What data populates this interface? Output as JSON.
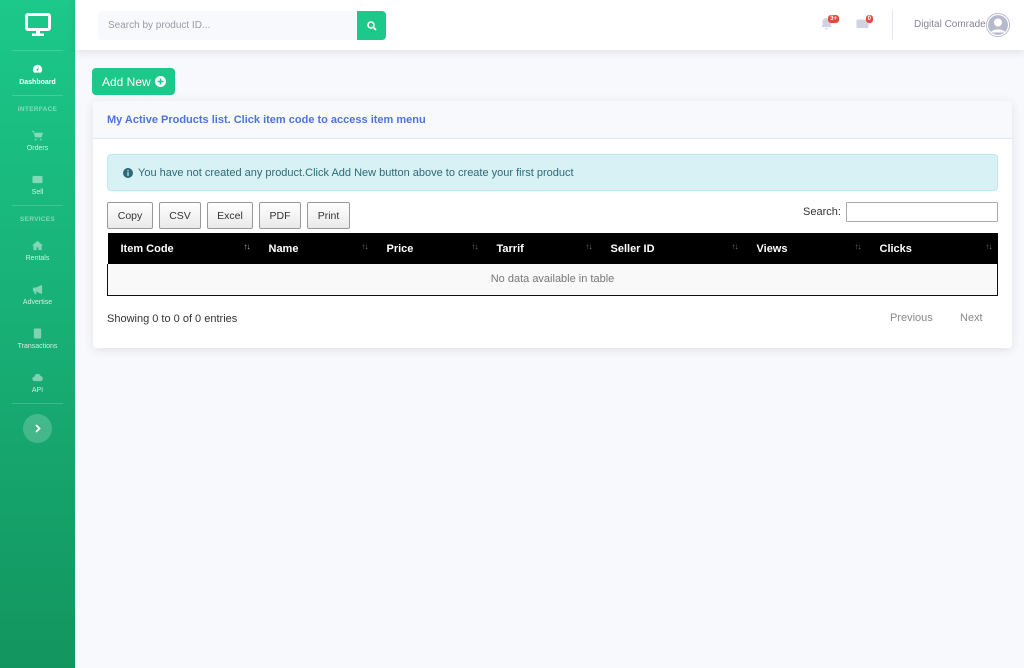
{
  "sidebar": {
    "items": [
      {
        "label": "Dashboard",
        "icon": "tachometer-icon",
        "active": true
      },
      {
        "label": "Orders",
        "icon": "cart-icon"
      },
      {
        "label": "Sell",
        "icon": "money-icon"
      },
      {
        "label": "Rentals",
        "icon": "home-icon"
      },
      {
        "label": "Advertise",
        "icon": "bullhorn-icon"
      },
      {
        "label": "Transactions",
        "icon": "receipt-icon"
      },
      {
        "label": "API",
        "icon": "cloud-icon"
      }
    ],
    "headings": {
      "interface": "INTERFACE",
      "services": "SERVICES"
    }
  },
  "topbar": {
    "search_placeholder": "Search by product ID...",
    "alerts_badge": "3+",
    "messages_badge": "0",
    "user_name": "Digital Comrade"
  },
  "main": {
    "add_new_label": "Add New",
    "card_title": "My Active Products list. Click item code to access item menu",
    "info_message": "You have not created any product.Click Add New button above to create your first product",
    "export_buttons": [
      "Copy",
      "CSV",
      "Excel",
      "PDF",
      "Print"
    ],
    "search_label": "Search:",
    "table": {
      "columns": [
        "Item Code",
        "Name",
        "Price",
        "Tarrif",
        "Seller ID",
        "Views",
        "Clicks"
      ],
      "empty_message": "No data available in table"
    },
    "entries_info": "Showing 0 to 0 of 0 entries",
    "pagination": {
      "previous": "Previous",
      "next": "Next"
    }
  },
  "colors": {
    "primary": "#1cc88a",
    "link": "#4e73df",
    "badge": "#e74a3b"
  }
}
